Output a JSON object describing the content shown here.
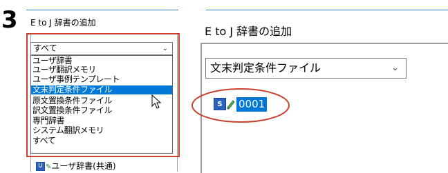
{
  "step_number": "3",
  "left_panel": {
    "title": "E to J 辞書の追加",
    "select_value": "すべて",
    "options": [
      "ユーザ辞書",
      "ユーザ翻訳メモリ",
      "ユーザ事例テンプレート",
      "文末判定条件ファイル",
      "原文置換条件ファイル",
      "訳文置換条件ファイル",
      "専門辞書",
      "システム翻訳メモリ",
      "すべて"
    ],
    "selected_option": "文末判定条件ファイル",
    "bottom_item_label": "ユーザ辞書(共通)",
    "bottom_item_icon": "U"
  },
  "right_panel": {
    "title": "E to J 辞書の追加",
    "select_value": "文末判定条件ファイル",
    "entry_icon": "S",
    "entry_label": "0001"
  },
  "colors": {
    "accent_line": "#2f7fc9",
    "highlight": "#0078d7",
    "callout_red": "#c8412f"
  }
}
